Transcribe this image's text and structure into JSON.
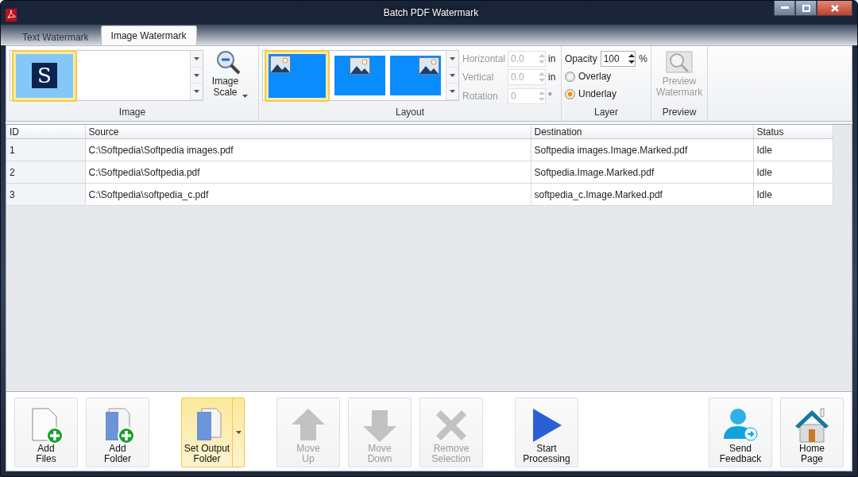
{
  "window": {
    "title": "Batch PDF Watermark"
  },
  "tabs": [
    {
      "label": "Text Watermark",
      "selected": false
    },
    {
      "label": "Image Watermark",
      "selected": true
    }
  ],
  "ribbon": {
    "image_group": {
      "label": "Image",
      "gallery": [
        {
          "glyph": "S",
          "selected": true
        }
      ],
      "scale_button": {
        "label": "Image Scale"
      }
    },
    "layout_group": {
      "label": "Layout",
      "gallery": [
        {
          "kind": "left",
          "selected": true
        },
        {
          "kind": "center",
          "selected": false
        },
        {
          "kind": "right",
          "selected": false
        }
      ],
      "fields": [
        {
          "label": "Horizontal",
          "value": "0.0",
          "unit": "in",
          "disabled": true
        },
        {
          "label": "Vertical",
          "value": "0.0",
          "unit": "in",
          "disabled": true
        },
        {
          "label": "Rotation",
          "value": "0",
          "unit": "°",
          "disabled": true
        }
      ]
    },
    "layer_group": {
      "label": "Layer",
      "opacity": {
        "label": "Opacity",
        "value": "100",
        "unit": "%"
      },
      "options": [
        {
          "label": "Overlay",
          "selected": false
        },
        {
          "label": "Underlay",
          "selected": true
        }
      ]
    },
    "preview_group": {
      "label": "Preview",
      "button": {
        "label": "Preview Watermark",
        "disabled": true
      }
    }
  },
  "table": {
    "columns": [
      "ID",
      "Source",
      "Destination",
      "Status"
    ],
    "rows": [
      [
        "1",
        "C:\\Softpedia\\Softpedia images.pdf",
        "Softpedia images.Image.Marked.pdf",
        "Idle"
      ],
      [
        "2",
        "C:\\Softpedia\\Softpedia.pdf",
        "Softpedia.Image.Marked.pdf",
        "Idle"
      ],
      [
        "3",
        "C:\\Softpedia\\softpedia_c.pdf",
        "softpedia_c.Image.Marked.pdf",
        "Idle"
      ]
    ]
  },
  "toolbar": {
    "groups": [
      {
        "buttons": [
          {
            "kind": "file-add",
            "label": "Add\nFiles",
            "disabled": false,
            "highlighted": false
          },
          {
            "kind": "folder-add",
            "label": "Add\nFolder",
            "disabled": false,
            "highlighted": false
          }
        ]
      },
      {
        "buttons": [
          {
            "kind": "folder",
            "label": "Set Output\nFolder",
            "disabled": false,
            "highlighted": true,
            "dropdown": true
          }
        ]
      },
      {
        "buttons": [
          {
            "kind": "arrow-up",
            "label": "Move\nUp",
            "disabled": true,
            "highlighted": false
          },
          {
            "kind": "arrow-down",
            "label": "Move\nDown",
            "disabled": true,
            "highlighted": false
          },
          {
            "kind": "cross",
            "label": "Remove\nSelection",
            "disabled": true,
            "highlighted": false
          }
        ]
      },
      {
        "buttons": [
          {
            "kind": "play",
            "label": "Start\nProcessing",
            "disabled": false,
            "highlighted": false
          }
        ]
      },
      {
        "buttons": [
          {
            "kind": "person",
            "label": "Send\nFeedback",
            "disabled": false,
            "highlighted": false
          },
          {
            "kind": "house",
            "label": "Home\nPage",
            "disabled": false,
            "highlighted": false
          }
        ]
      }
    ]
  }
}
